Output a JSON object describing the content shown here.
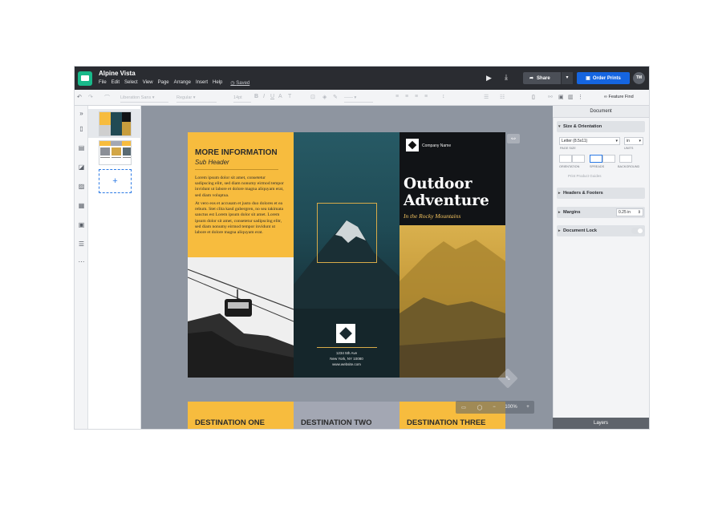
{
  "app": {
    "doc_title": "Alpine Vista",
    "menu": [
      "File",
      "Edit",
      "Select",
      "View",
      "Page",
      "Arrange",
      "Insert",
      "Help"
    ],
    "saved_label": "Saved",
    "share_label": "Share",
    "order_prints_label": "Order Prints",
    "avatar_initials": "TM",
    "accent_color": "#1565e0",
    "brand_color": "#19b98a"
  },
  "toolbar": {
    "font_family": "Liberation Sans",
    "font_weight": "Regular",
    "font_size": "14pt",
    "feature_find_label": "Feature Find"
  },
  "sidebar": {
    "tab": "Document",
    "size_orientation": "Size & Orientation",
    "page_size_value": "Letter (8.5x11)",
    "units_value": "in",
    "page_size_label": "PAGE SIZE",
    "units_label": "UNITS",
    "orientation_label": "ORIENTATION",
    "spreads_label": "SPREADS",
    "background_label": "BACKGROUND",
    "print_guides_label": "Print Product Guides",
    "headers_footers": "Headers & Footers",
    "margins": "Margins",
    "margins_value": "0.25 in",
    "document_lock": "Document Lock",
    "layers": "Layers"
  },
  "brochure": {
    "more_info": "MORE INFORMATION",
    "sub_header": "Sub Header",
    "para1": "Lorem ipsum dolor sit amet, consetetur sadipscing elitr, sed diam nonumy eirmod tempor invidunt ut labore et dolore magna aliquyam erat, sed diam voluptua.",
    "para2": "At vero eos et accusam et justo duo dolores et ea rebum. Stet clita kasd gubergren, no sea takimata sanctus est Lorem ipsum dolor sit amet. Lorem ipsum dolor sit amet, consetetur sadipscing elitr, sed diam nonumy eirmod tempor invidunt ut labore et dolore magna aliquyam erat.",
    "address1": "1234 5th Ave",
    "address2": "New York, NY 10080",
    "address3": "www.website.com",
    "company_name": "Company Name",
    "title": "Outdoor Adventure",
    "tagline": "In the Rocky Mountains",
    "dest1": "DESTINATION ONE",
    "dest2": "DESTINATION TWO",
    "dest3": "DESTINATION THREE"
  },
  "zoom": {
    "level": "100%"
  }
}
